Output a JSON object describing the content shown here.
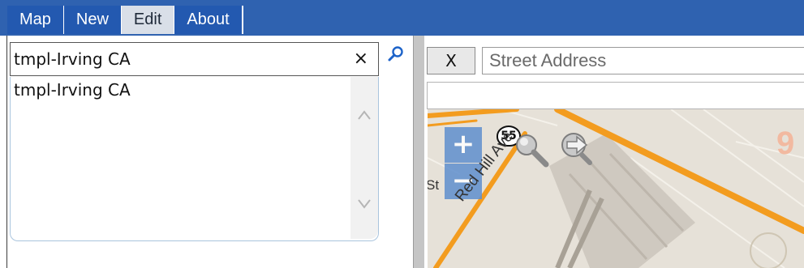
{
  "nav": {
    "tabs": [
      {
        "label": "Map"
      },
      {
        "label": "New"
      },
      {
        "label": "Edit"
      },
      {
        "label": "About"
      }
    ],
    "active_tab": "Edit"
  },
  "left": {
    "search_value": "tmpl-Irving CA",
    "clear_symbol": "×",
    "results": [
      {
        "label": "tmpl-Irving CA"
      }
    ]
  },
  "right": {
    "clear_button_label": "X",
    "address_placeholder": "Street Address",
    "second_field_value": ""
  },
  "map": {
    "zoom_in_label": "+",
    "zoom_out_label": "−",
    "route_shield": "55",
    "street_label": "Red Hill Ave",
    "street_fragment": "St",
    "corner_number": "9",
    "icons": [
      "zoom-magnifier-icon",
      "forward-arrow-icon"
    ]
  },
  "colors": {
    "nav_bar": "#2f62b0",
    "active_tab": "#d9dfe8",
    "road_orange": "#f39c1f",
    "map_base": "#e6e1d8",
    "zoom_button": "#5f8fce"
  }
}
